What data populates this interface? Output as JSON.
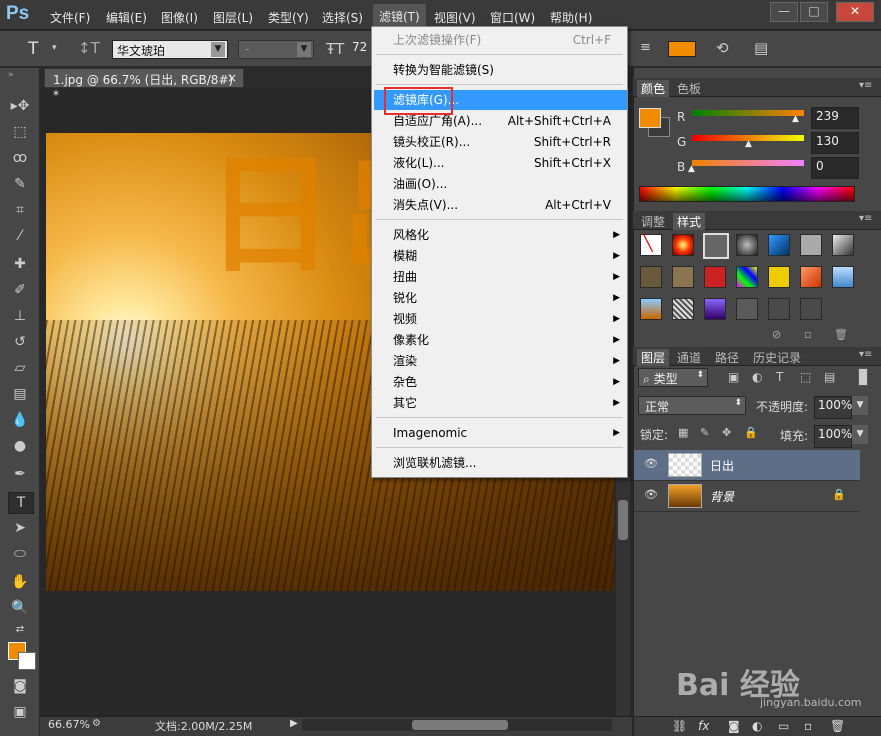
{
  "app": {
    "logo": "Ps"
  },
  "menubar": {
    "items": [
      "文件(F)",
      "编辑(E)",
      "图像(I)",
      "图层(L)",
      "类型(Y)",
      "选择(S)",
      "滤镜(T)",
      "视图(V)",
      "窗口(W)",
      "帮助(H)"
    ]
  },
  "options": {
    "font_family": "华文琥珀",
    "font_style": "-",
    "font_size": "72",
    "text_color": "#f08c00"
  },
  "document": {
    "tab_title": "1.jpg @ 66.7% (日出, RGB/8#) *",
    "tab_close": "×",
    "overlay_text": "日出",
    "zoom": "66.67%",
    "doc_size": "文档:2.00M/2.25M"
  },
  "filter_menu": {
    "items": [
      {
        "label": "上次滤镜操作(F)",
        "shortcut": "Ctrl+F",
        "disabled": true
      },
      {
        "label": "转换为智能滤镜(S)",
        "shortcut": ""
      },
      {
        "label": "滤镜库(G)...",
        "shortcut": "",
        "highlighted": true
      },
      {
        "label": "自适应广角(A)...",
        "shortcut": "Alt+Shift+Ctrl+A"
      },
      {
        "label": "镜头校正(R)...",
        "shortcut": "Shift+Ctrl+R"
      },
      {
        "label": "液化(L)...",
        "shortcut": "Shift+Ctrl+X"
      },
      {
        "label": "油画(O)...",
        "shortcut": ""
      },
      {
        "label": "消失点(V)...",
        "shortcut": "Alt+Ctrl+V"
      },
      {
        "label": "风格化",
        "submenu": true
      },
      {
        "label": "模糊",
        "submenu": true
      },
      {
        "label": "扭曲",
        "submenu": true
      },
      {
        "label": "锐化",
        "submenu": true
      },
      {
        "label": "视频",
        "submenu": true
      },
      {
        "label": "像素化",
        "submenu": true
      },
      {
        "label": "渲染",
        "submenu": true
      },
      {
        "label": "杂色",
        "submenu": true
      },
      {
        "label": "其它",
        "submenu": true
      },
      {
        "label": "Imagenomic",
        "submenu": true
      },
      {
        "label": "浏览联机滤镜..."
      }
    ]
  },
  "color_panel": {
    "tabs": [
      "颜色",
      "色板"
    ],
    "r_label": "R",
    "g_label": "G",
    "b_label": "B",
    "r": "239",
    "g": "130",
    "b": "0",
    "foreground": "#ef8200"
  },
  "styles_panel": {
    "tabs": [
      "调整",
      "样式"
    ]
  },
  "layers_panel": {
    "tabs": [
      "图层",
      "通道",
      "路径",
      "历史记录"
    ],
    "filter_kind": "类型",
    "blend_mode": "正常",
    "opacity_label": "不透明度:",
    "opacity": "100%",
    "lock_label": "锁定:",
    "fill_label": "填充:",
    "fill": "100%",
    "layers": [
      {
        "name": "日出",
        "selected": true
      },
      {
        "name": "背景",
        "locked": true
      }
    ]
  },
  "watermark": {
    "text": "Bai 经验",
    "sub": "jingyan.baidu.com"
  }
}
